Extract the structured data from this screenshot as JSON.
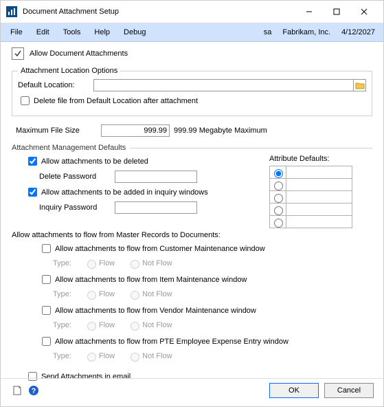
{
  "window": {
    "title": "Document Attachment Setup"
  },
  "menubar": {
    "items": [
      "File",
      "Edit",
      "Tools",
      "Help",
      "Debug"
    ],
    "user": "sa",
    "company": "Fabrikam, Inc.",
    "date": "4/12/2027"
  },
  "allow_doc_attachments": {
    "label": "Allow Document Attachments"
  },
  "location": {
    "legend": "Attachment Location Options",
    "default_label": "Default Location:",
    "default_value": "",
    "delete_after_label": "Delete file from Default Location after attachment",
    "delete_after_checked": false
  },
  "max_file": {
    "label": "Maximum File Size",
    "value": "999.99",
    "suffix": "999.99 Megabyte Maximum"
  },
  "management": {
    "section_title": "Attachment Management Defaults",
    "allow_delete": {
      "label": "Allow attachments to be deleted",
      "checked": true
    },
    "delete_pwd_label": "Delete Password",
    "delete_pwd_value": "",
    "allow_inquiry": {
      "label": "Allow attachments to be added in inquiry windows",
      "checked": true
    },
    "inquiry_pwd_label": "Inquiry Password",
    "inquiry_pwd_value": "",
    "flow_master_label": "Allow attachments to flow from Master Records to Documents:",
    "flow_items": [
      {
        "label": "Allow attachments to flow from Customer Maintenance window",
        "checked": false
      },
      {
        "label": "Allow attachments to flow from Item Maintenance window",
        "checked": false
      },
      {
        "label": "Allow attachments to flow from Vendor Maintenance window",
        "checked": false
      },
      {
        "label": "Allow attachments to flow from PTE Employee Expense Entry window",
        "checked": false
      }
    ],
    "type_label": "Type:",
    "flow_option": "Flow",
    "not_flow_option": "Not Flow"
  },
  "attr_defaults": {
    "title": "Attribute Defaults:",
    "rows": 5,
    "selected": 0
  },
  "send_email": {
    "label": "Send Attachments in email",
    "checked": false
  },
  "buttons": {
    "ok": "OK",
    "cancel": "Cancel"
  }
}
